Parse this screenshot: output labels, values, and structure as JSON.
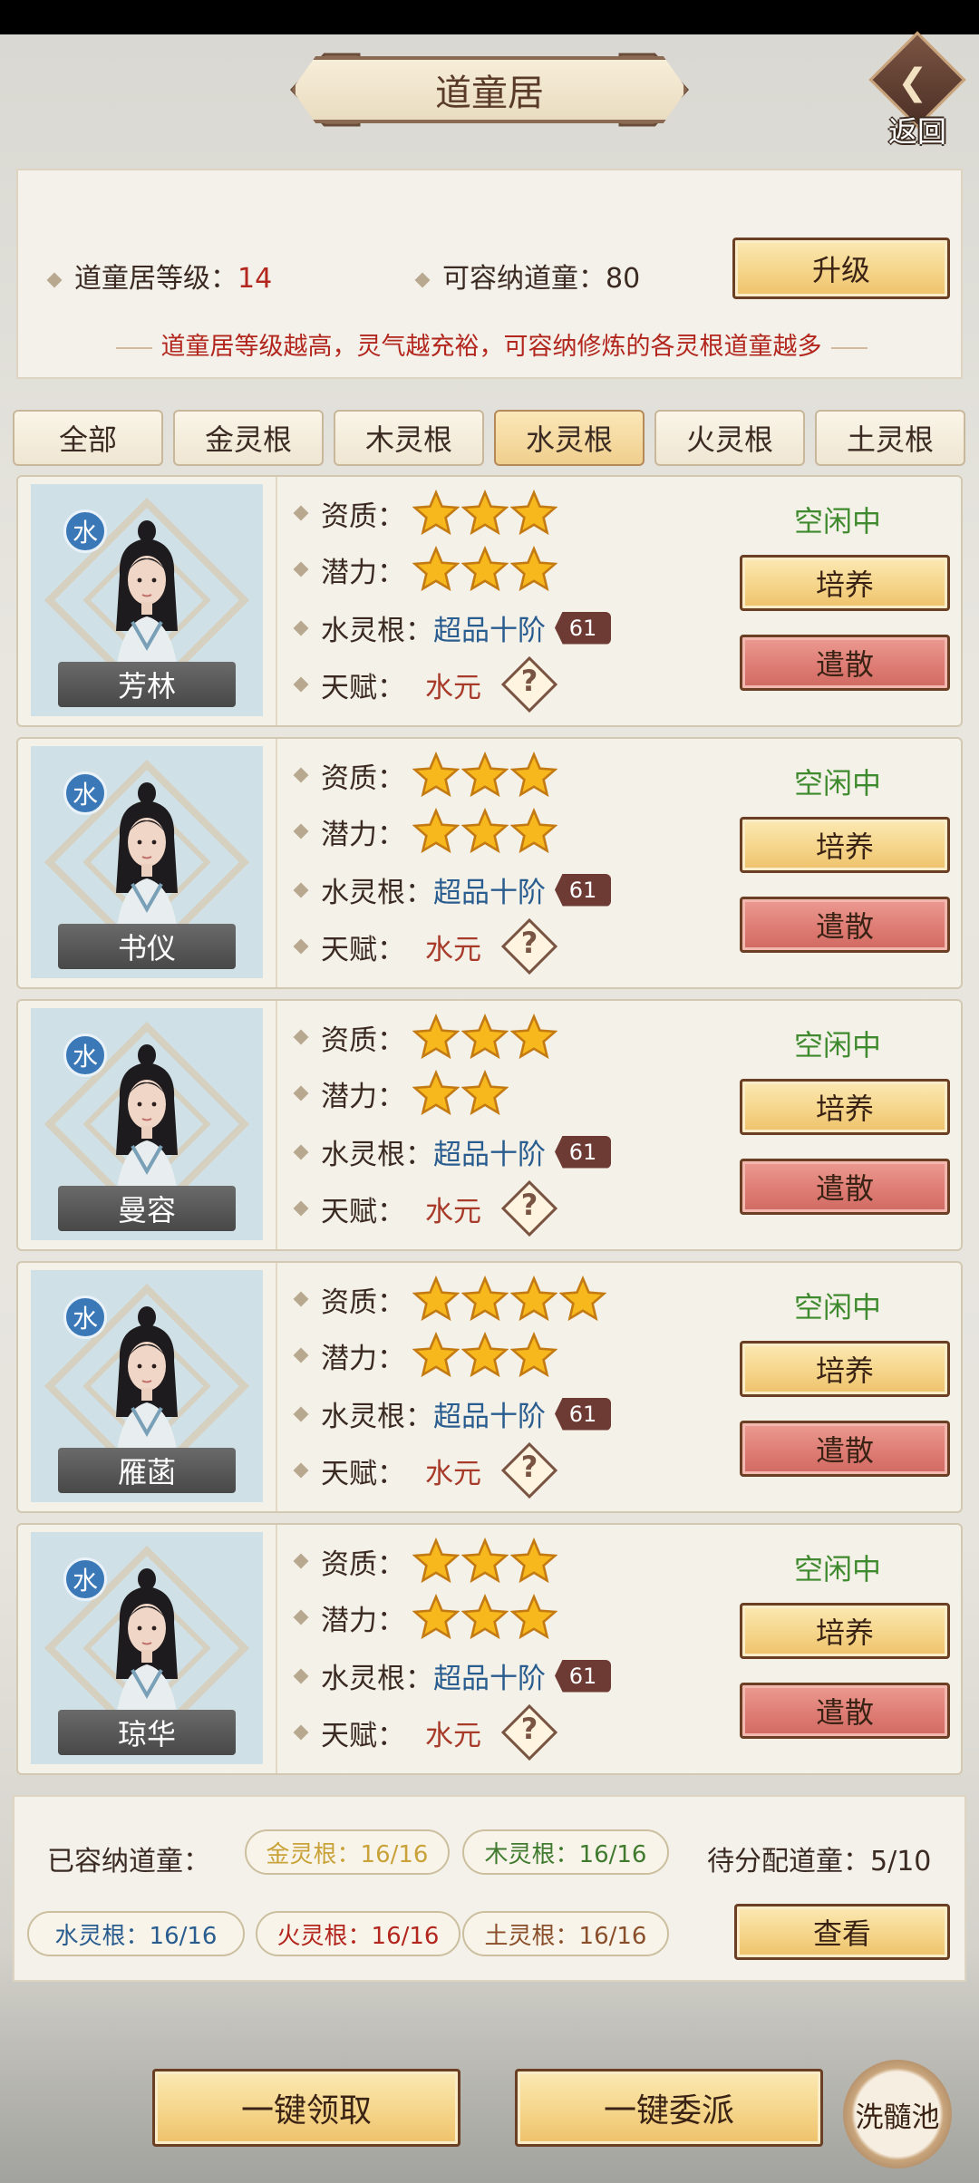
{
  "header": {
    "title": "道童居",
    "back_label": "返回"
  },
  "info": {
    "level_label": "道童居等级：",
    "level_value": "14",
    "capacity_label": "可容纳道童：80",
    "upgrade_label": "升级",
    "description": "道童居等级越高，灵气越充裕，可容纳修炼的各灵根道童越多"
  },
  "tabs": [
    {
      "label": "全部",
      "active": false
    },
    {
      "label": "金灵根",
      "active": false
    },
    {
      "label": "木灵根",
      "active": false
    },
    {
      "label": "水灵根",
      "active": true
    },
    {
      "label": "火灵根",
      "active": false
    },
    {
      "label": "土灵根",
      "active": false
    }
  ],
  "labels": {
    "aptitude": "资质：",
    "potential": "潜力：",
    "root": "水灵根：",
    "talent": "天赋：",
    "train": "培养",
    "dismiss": "遣散"
  },
  "disciples": [
    {
      "name": "芳林",
      "element": "水",
      "aptitude_stars": 3,
      "potential_stars": 3,
      "root_grade": "超品十阶",
      "root_level": "61",
      "talent": "水元",
      "status": "空闲中"
    },
    {
      "name": "书仪",
      "element": "水",
      "aptitude_stars": 3,
      "potential_stars": 3,
      "root_grade": "超品十阶",
      "root_level": "61",
      "talent": "水元",
      "status": "空闲中"
    },
    {
      "name": "曼容",
      "element": "水",
      "aptitude_stars": 3,
      "potential_stars": 2,
      "root_grade": "超品十阶",
      "root_level": "61",
      "talent": "水元",
      "status": "空闲中"
    },
    {
      "name": "雁菡",
      "element": "水",
      "aptitude_stars": 4,
      "potential_stars": 3,
      "root_grade": "超品十阶",
      "root_level": "61",
      "talent": "水元",
      "status": "空闲中"
    },
    {
      "name": "琼华",
      "element": "水",
      "aptitude_stars": 3,
      "potential_stars": 3,
      "root_grade": "超品十阶",
      "root_level": "61",
      "talent": "水元",
      "status": "空闲中"
    }
  ],
  "summary": {
    "housed_label": "已容纳道童：",
    "pending_label": "待分配道童：5/10",
    "view_label": "查看",
    "pills": [
      {
        "text": "金灵根：16/16",
        "color": "#c9a23a"
      },
      {
        "text": "木灵根：16/16",
        "color": "#3f7a2e"
      },
      {
        "text": "水灵根：16/16",
        "color": "#2a5d8f"
      },
      {
        "text": "火灵根：16/16",
        "color": "#b2261e"
      },
      {
        "text": "土灵根：16/16",
        "color": "#8a4f2a"
      }
    ]
  },
  "footer": {
    "claim_all": "一键领取",
    "assign_all": "一键委派",
    "pool": "洗髓池"
  }
}
